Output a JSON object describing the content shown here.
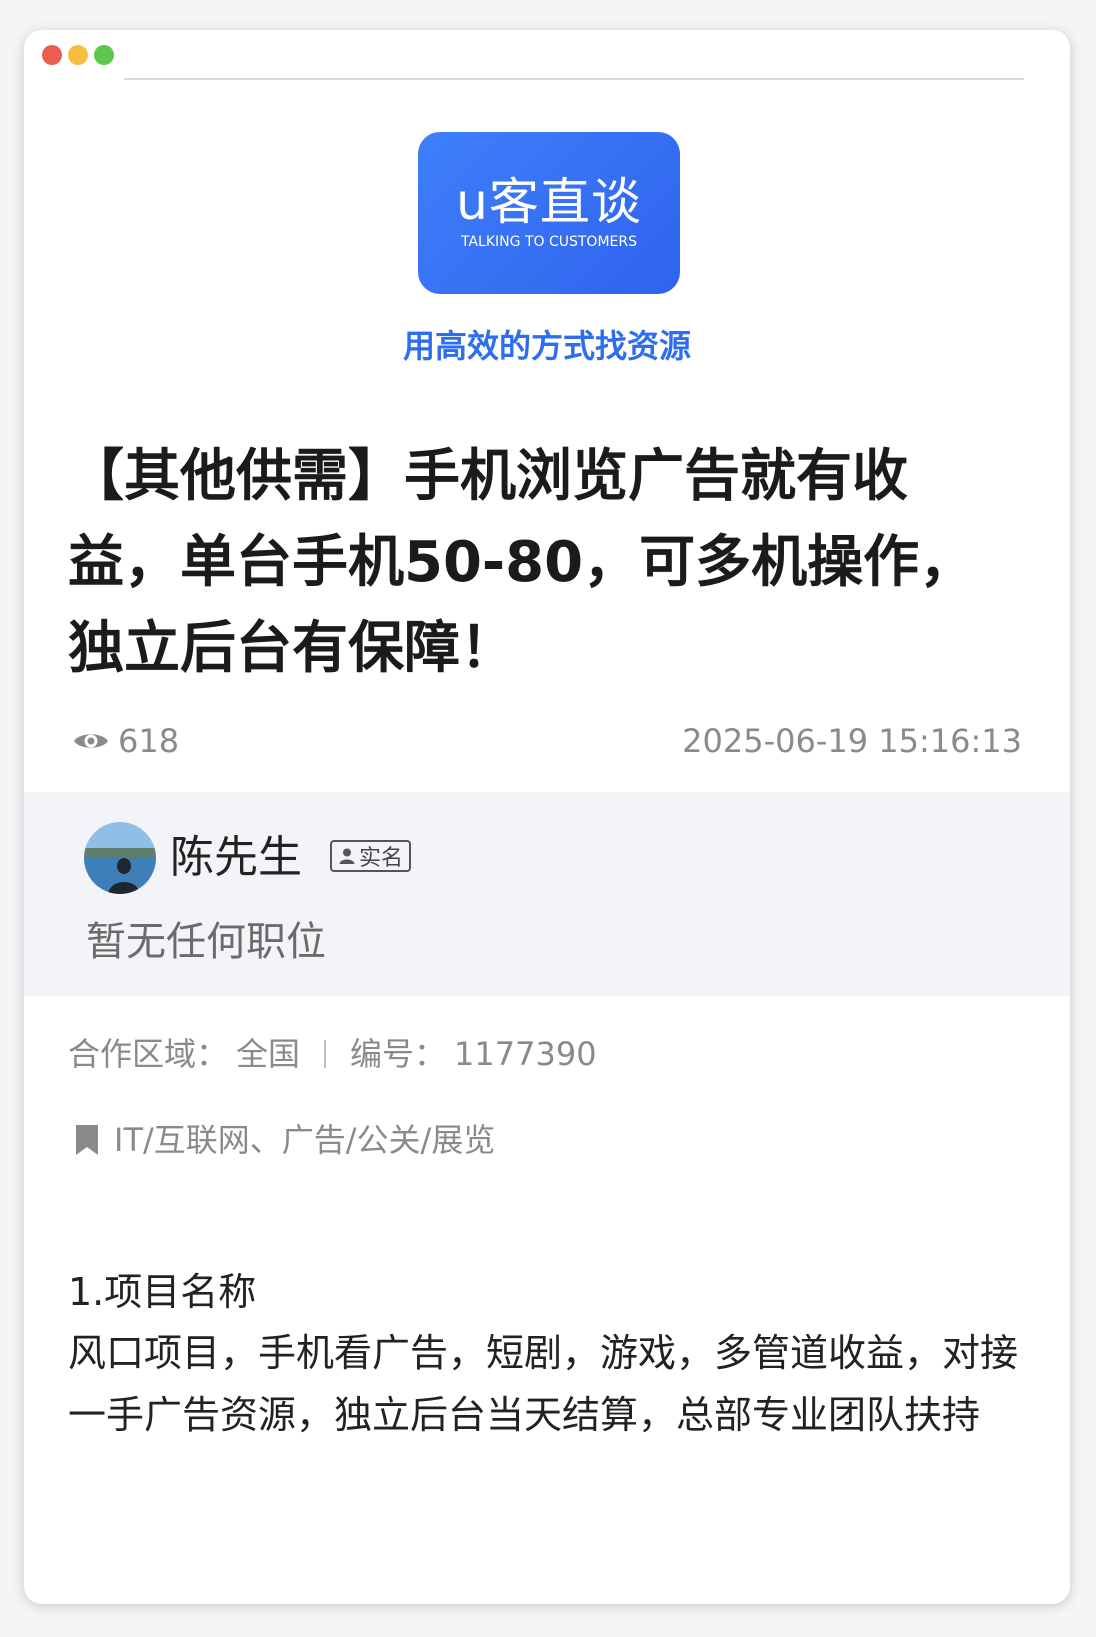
{
  "brand": {
    "logo_title": "u客直谈",
    "logo_subtitle": "TALKING TO CUSTOMERS",
    "slogan": "用高效的方式找资源",
    "colors": {
      "brand_blue": "#2f63ee",
      "slogan_blue": "#2d6df0"
    }
  },
  "post": {
    "title": "【其他供需】手机浏览广告就有收益，单台手机50-80，可多机操作，独立后台有保障！",
    "views": "618",
    "timestamp": "2025-06-19  15:16:13"
  },
  "author": {
    "name": "陈先生",
    "badge": "实名",
    "position": "暂无任何职位"
  },
  "meta": {
    "region_label": "合作区域：",
    "region_value": "全国",
    "id_label": "编号：",
    "id_value": "1177390"
  },
  "tags": "IT/互联网、广告/公关/展览",
  "body": {
    "heading": "1.项目名称",
    "text": "风口项目，手机看广告，短剧，游戏，多管道收益，对接一手广告资源，独立后台当天结算，总部专业团队扶持"
  },
  "icons": [
    "eye-icon",
    "person-icon",
    "bookmark-icon"
  ]
}
